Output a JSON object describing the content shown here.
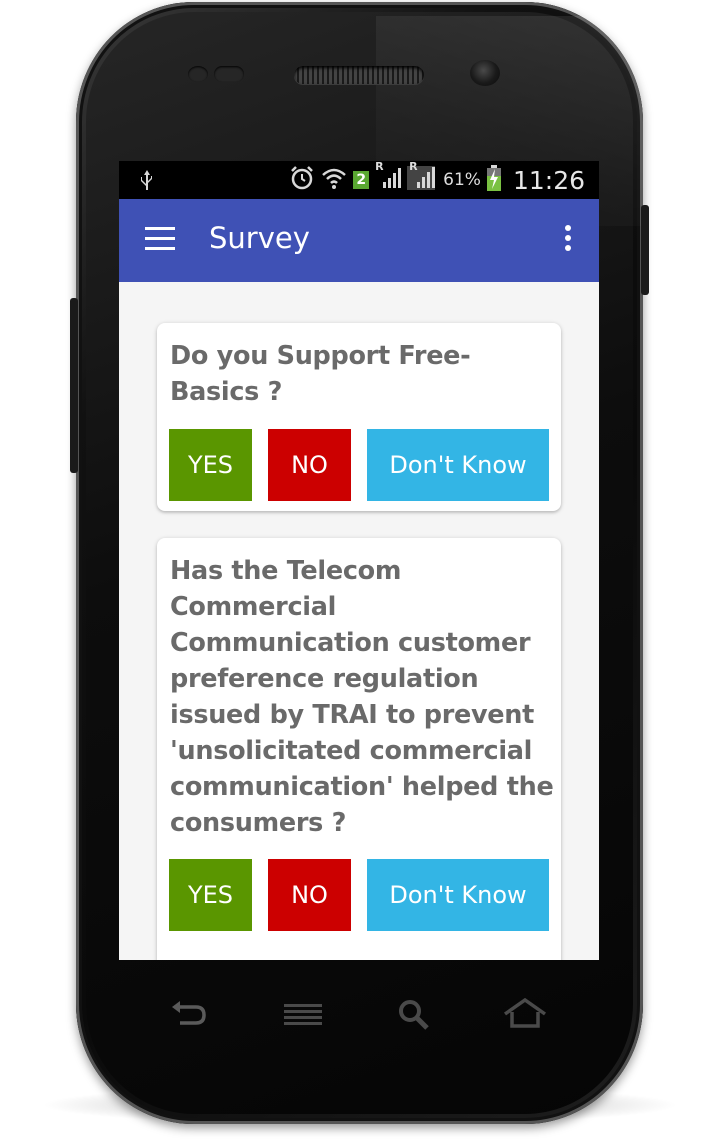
{
  "status_bar": {
    "icons": [
      "usb-icon",
      "alarm-icon",
      "wifi-icon",
      "sim-2-badge",
      "roaming-signal-icon",
      "roaming-signal-icon-2",
      "battery-charging-icon"
    ],
    "sim_badge": "2",
    "roaming_mark": "R",
    "battery_percent": "61%",
    "time": "11:26"
  },
  "toolbar": {
    "title": "Survey",
    "color": "#3f51b5"
  },
  "survey": {
    "questions": [
      {
        "text": "Do you Support Free-Basics ?",
        "yes_label": "YES",
        "no_label": "NO",
        "dont_know_label": "Don't Know"
      },
      {
        "text": "Has the Telecom Commercial Communication customer preference regulation issued by TRAI to prevent 'unsolicitated commercial communication' helped the consumers ?",
        "yes_label": "YES",
        "no_label": "NO",
        "dont_know_label": "Don't Know"
      }
    ]
  },
  "colors": {
    "yes": "#5a9600",
    "no": "#cc0000",
    "dont_know": "#33b5e5"
  },
  "nav_keys": [
    "back-icon",
    "menu-icon",
    "search-icon",
    "home-icon"
  ]
}
